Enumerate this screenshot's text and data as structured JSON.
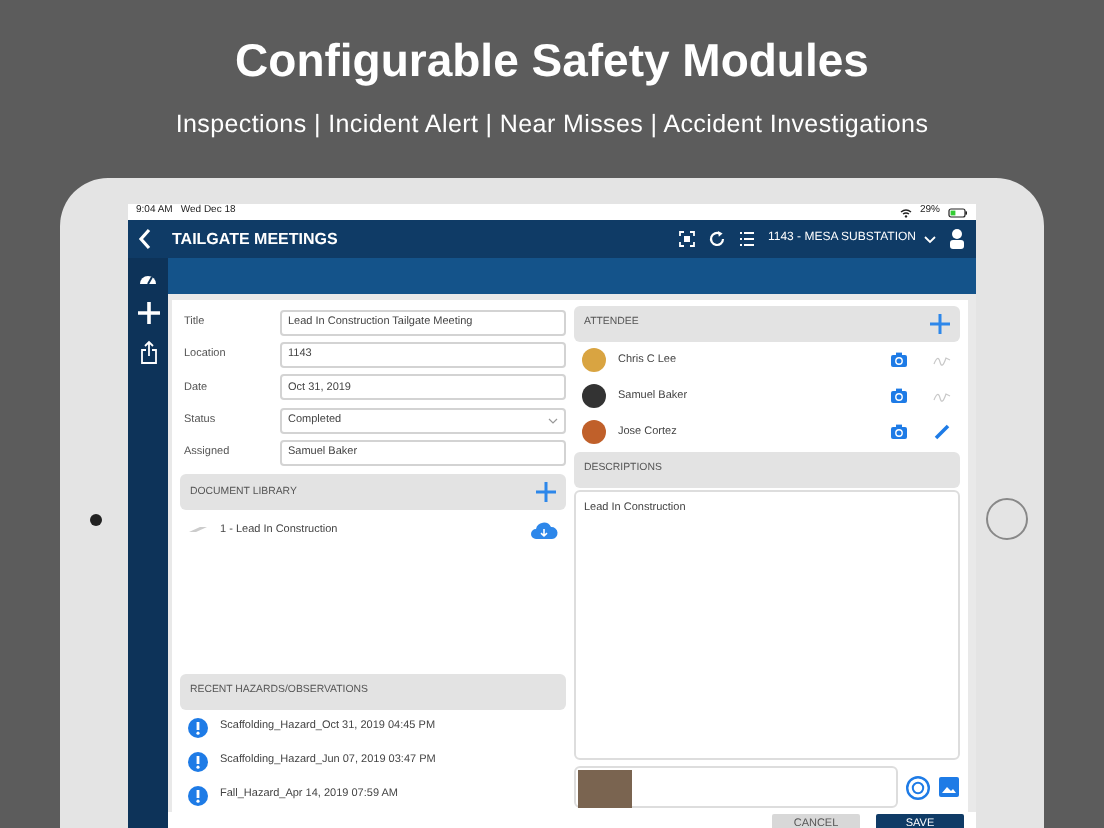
{
  "promo": {
    "title": "Configurable Safety Modules",
    "subtitle": "Inspections | Incident Alert | Near Misses | Accident Investigations"
  },
  "status_bar": {
    "time": "9:04 AM",
    "date": "Wed Dec 18",
    "battery": "29%"
  },
  "nav": {
    "title": "TAILGATE MEETINGS",
    "site": "1143 - MESA SUBSTATION"
  },
  "form": [
    {
      "label": "Title",
      "value": "Lead In Construction Tailgate Meeting",
      "kind": "text"
    },
    {
      "label": "Location",
      "value": "1143",
      "kind": "text"
    },
    {
      "label": "Date",
      "value": "Oct 31, 2019",
      "kind": "text"
    },
    {
      "label": "Status",
      "value": "Completed",
      "kind": "select"
    },
    {
      "label": "Assigned",
      "value": "Samuel Baker",
      "kind": "text"
    }
  ],
  "document_library": {
    "header": "DOCUMENT LIBRARY",
    "items": [
      {
        "label": "1 - Lead In Construction"
      }
    ]
  },
  "recent_hazards": {
    "header": "RECENT HAZARDS/OBSERVATIONS",
    "items": [
      {
        "label": "Scaffolding_Hazard_Oct 31, 2019 04:45 PM"
      },
      {
        "label": "Scaffolding_Hazard_Jun 07, 2019 03:47 PM"
      },
      {
        "label": "Fall_Hazard_Apr 14, 2019 07:59 AM"
      }
    ]
  },
  "attendees": {
    "header": "ATTENDEE",
    "items": [
      {
        "name": "Chris C Lee",
        "signed": true
      },
      {
        "name": "Samuel Baker",
        "signed": true
      },
      {
        "name": "Jose Cortez",
        "signed": false
      }
    ]
  },
  "descriptions": {
    "header": "DESCRIPTIONS",
    "text": "Lead In Construction"
  },
  "buttons": [
    {
      "label": "CANCEL",
      "kind": "secondary"
    },
    {
      "label": "SAVE",
      "kind": "primary"
    }
  ]
}
